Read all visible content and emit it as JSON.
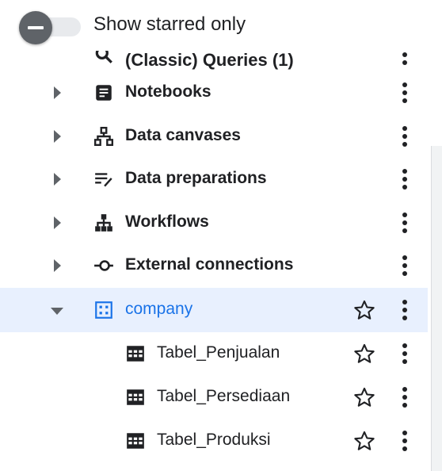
{
  "toggle": {
    "label": "Show starred only",
    "checked": false
  },
  "cut_row": {
    "label": "(Classic) Queries (1)"
  },
  "tree": [
    {
      "label": "Notebooks",
      "icon": "notebook-icon",
      "expanded": false
    },
    {
      "label": "Data canvases",
      "icon": "data-canvas-icon",
      "expanded": false
    },
    {
      "label": "Data preparations",
      "icon": "data-preparation-icon",
      "expanded": false
    },
    {
      "label": "Workflows",
      "icon": "workflow-icon",
      "expanded": false
    },
    {
      "label": "External connections",
      "icon": "external-connection-icon",
      "expanded": false
    },
    {
      "label": "company",
      "icon": "dataset-icon",
      "expanded": true,
      "selected": true
    },
    {
      "label": "Tabel_Penjualan",
      "icon": "table-icon"
    },
    {
      "label": "Tabel_Persediaan",
      "icon": "table-icon"
    },
    {
      "label": "Tabel_Produksi",
      "icon": "table-icon"
    }
  ],
  "colors": {
    "selected_bg": "#e8f0fe",
    "accent": "#1a73e8",
    "icon": "#202124"
  }
}
